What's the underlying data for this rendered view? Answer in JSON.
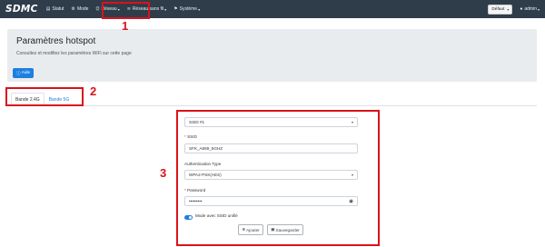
{
  "navbar": {
    "brand": "SDMC",
    "items": [
      {
        "label": "Statut",
        "icon": "status-icon"
      },
      {
        "label": "Mode",
        "icon": "mode-icon"
      },
      {
        "label": "Réseau",
        "icon": "network-icon",
        "caret": "▾"
      },
      {
        "label": "Réseau sans fil",
        "icon": "wifi-icon",
        "caret": "▾"
      },
      {
        "label": "Système",
        "icon": "system-icon",
        "caret": "▾"
      }
    ],
    "lang_value": "Défaut",
    "user": "admin"
  },
  "header": {
    "title": "Paramètres hotspot",
    "subtitle": "Consultez et modifiez les paramètres WiFi sur cette page",
    "help_label": "Aide"
  },
  "tabs": [
    {
      "label": "Bande 2.4G",
      "active": true
    },
    {
      "label": "Bande 5G",
      "active": false
    }
  ],
  "form": {
    "ssid_select_value": "SSID #1",
    "ssid_label": "SSID",
    "ssid_value": "SFK_A869_5GHZ",
    "auth_label": "Authentication Type",
    "auth_value": "WPA2-PSK(AES)",
    "password_label": "Password",
    "password_value": "•••••••••",
    "unified_label": "Mode avec SSID unifié",
    "add_label": "Ajouter",
    "save_label": "Sauvegarder"
  },
  "annotations": {
    "one": "1",
    "two": "2",
    "three": "3"
  },
  "colors": {
    "navbar": "#2f3d4a",
    "primary": "#1d7fe0",
    "annotation_red": "#d9121b"
  }
}
